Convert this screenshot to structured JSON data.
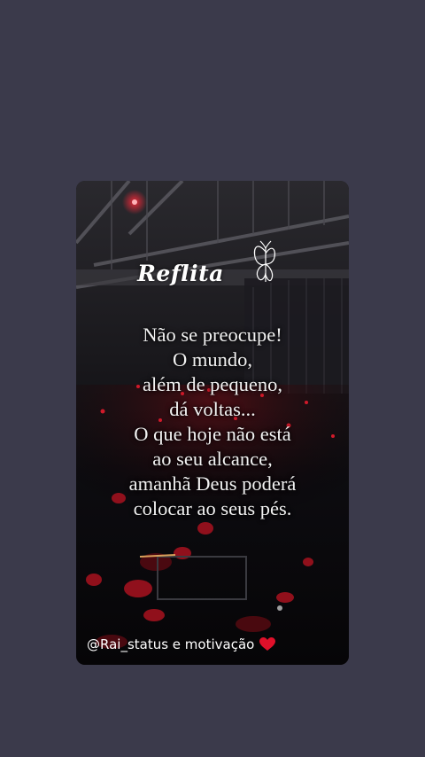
{
  "post": {
    "title": "Reflita",
    "quote_lines": [
      "Não se preocupe!",
      "O mundo,",
      "além de pequeno,",
      "dá voltas...",
      "O que hoje não está",
      "ao seu alcance,",
      "amanhã Deus poderá",
      "colocar ao seus pés."
    ],
    "watermark": "@Rai_status e motivação",
    "heart_color": "#e0102a",
    "accent_color": "#c8102e"
  },
  "background": {
    "page_color": "#3b3a4b",
    "icons": [
      "butterfly-icon",
      "heart-icon"
    ]
  }
}
